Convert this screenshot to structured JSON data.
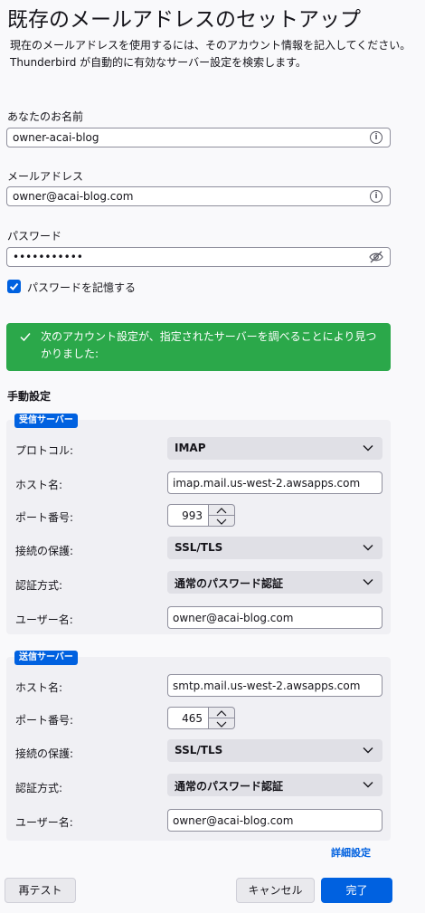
{
  "page": {
    "title": "既存のメールアドレスのセットアップ",
    "description": "現在のメールアドレスを使用するには、そのアカウント情報を記入してください。Thunderbird が自動的に有効なサーバー設定を検索します。"
  },
  "form": {
    "name_label": "あなたのお名前",
    "name_value": "owner-acai-blog",
    "email_label": "メールアドレス",
    "email_value": "owner@acai-blog.com",
    "password_label": "パスワード",
    "password_value": "•••••••••••",
    "remember_label": "パスワードを記憶する",
    "remember_checked": true
  },
  "banner": {
    "message": "次のアカウント設定が、指定されたサーバーを調べることにより見つかりました:",
    "color": "#2ba84a"
  },
  "manual": {
    "heading": "手動設定",
    "incoming": {
      "badge": "受信サーバー",
      "protocol_label": "プロトコル:",
      "protocol_value": "IMAP",
      "host_label": "ホスト名:",
      "host_value": "imap.mail.us-west-2.awsapps.com",
      "port_label": "ポート番号:",
      "port_value": "993",
      "security_label": "接続の保護:",
      "security_value": "SSL/TLS",
      "auth_label": "認証方式:",
      "auth_value": "通常のパスワード認証",
      "user_label": "ユーザー名:",
      "user_value": "owner@acai-blog.com"
    },
    "outgoing": {
      "badge": "送信サーバー",
      "host_label": "ホスト名:",
      "host_value": "smtp.mail.us-west-2.awsapps.com",
      "port_label": "ポート番号:",
      "port_value": "465",
      "security_label": "接続の保護:",
      "security_value": "SSL/TLS",
      "auth_label": "認証方式:",
      "auth_value": "通常のパスワード認証",
      "user_label": "ユーザー名:",
      "user_value": "owner@acai-blog.com"
    },
    "advanced_link": "詳細設定"
  },
  "buttons": {
    "retest": "再テスト",
    "cancel": "キャンセル",
    "done": "完了"
  },
  "colors": {
    "accent": "#0061e0",
    "success": "#2ba84a"
  }
}
